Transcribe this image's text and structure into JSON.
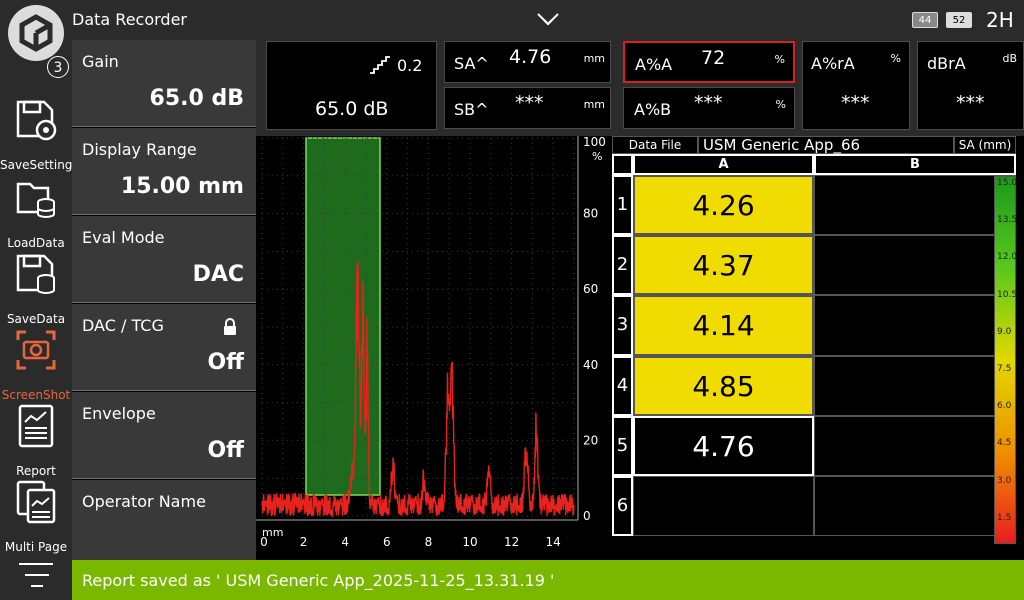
{
  "title_bar": {
    "app_title": "Data Recorder",
    "battery1": "44",
    "battery2": "52",
    "right_label": "2H"
  },
  "notification_count": "3",
  "toolbar": [
    {
      "label": "SaveSetting",
      "icon": "save-settings-icon"
    },
    {
      "label": "LoadData",
      "icon": "load-data-icon"
    },
    {
      "label": "SaveData",
      "icon": "save-data-icon"
    },
    {
      "label": "ScreenShot",
      "icon": "screenshot-icon"
    },
    {
      "label": "Report",
      "icon": "report-icon"
    },
    {
      "label": "Multi Page",
      "icon": "multi-page-icon"
    }
  ],
  "params": [
    {
      "label": "Gain",
      "value": "65.0 dB"
    },
    {
      "label": "Display Range",
      "value": "15.00 mm"
    },
    {
      "label": "Eval Mode",
      "value": "DAC"
    },
    {
      "label": "DAC / TCG",
      "value": "Off",
      "locked": true
    },
    {
      "label": "Envelope",
      "value": "Off"
    },
    {
      "label": "Operator Name",
      "value": ""
    }
  ],
  "gain_box": {
    "step": "0.2",
    "gain": "65.0 dB"
  },
  "readouts": [
    {
      "label": "SA^",
      "value": "4.76",
      "unit": "mm"
    },
    {
      "label": "SB^",
      "value": "***",
      "unit": "mm"
    },
    {
      "label": "A%A",
      "value": "72",
      "unit": "%"
    },
    {
      "label": "A%B",
      "value": "***",
      "unit": "%"
    },
    {
      "label": "A%rA",
      "value": "***",
      "unit": "%"
    },
    {
      "label": "dBrA",
      "value": "***",
      "unit": "dB"
    }
  ],
  "ascan": {
    "x_unit": "mm",
    "y_unit": "%",
    "x_ticks": [
      "0",
      "2",
      "4",
      "6",
      "8",
      "10",
      "12",
      "14"
    ],
    "y_ticks": [
      "100",
      "80",
      "60",
      "40",
      "20",
      "0"
    ]
  },
  "table": {
    "file_label": "Data File",
    "file_name": "USM Generic App_66",
    "column_header": "SA (mm)",
    "col_a": "A",
    "col_b": "B",
    "rows": [
      {
        "num": "1",
        "a": "4.26",
        "b": ""
      },
      {
        "num": "2",
        "a": "4.37",
        "b": ""
      },
      {
        "num": "3",
        "a": "4.14",
        "b": ""
      },
      {
        "num": "4",
        "a": "4.85",
        "b": ""
      },
      {
        "num": "5",
        "a": "4.76",
        "b": ""
      },
      {
        "num": "6",
        "a": "",
        "b": ""
      }
    ]
  },
  "color_scale": [
    "15.0",
    "13.5",
    "12.0",
    "10.5",
    "9.0",
    "7.5",
    "6.0",
    "4.5",
    "3.0",
    "1.5"
  ],
  "status_message": "Report saved as ' USM Generic App_2025-11-25_13.31.19 '",
  "colors": {
    "accent": "#7ab800",
    "highlight": "#f0dc00",
    "signal": "#e8231d",
    "gate": "#1e6b1e",
    "active_tool": "#e8663b"
  }
}
